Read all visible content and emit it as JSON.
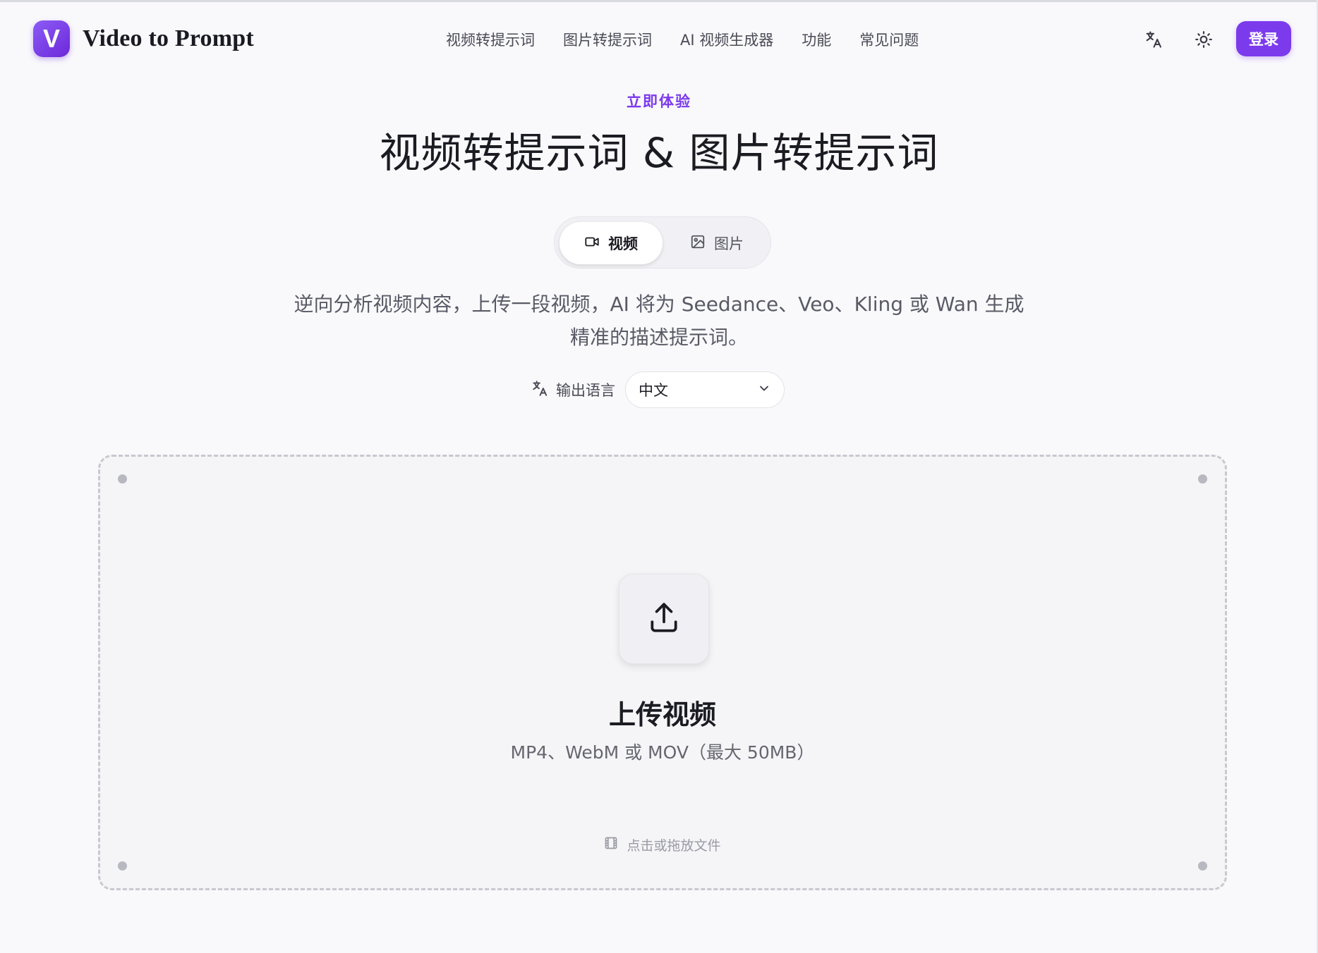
{
  "header": {
    "logo_letter": "V",
    "brand": "Video to Prompt",
    "nav": [
      {
        "label": "视频转提示词"
      },
      {
        "label": "图片转提示词"
      },
      {
        "label": "AI 视频生成器"
      },
      {
        "label": "功能"
      },
      {
        "label": "常见问题"
      }
    ],
    "icons": [
      "translate-icon",
      "sun-icon"
    ],
    "login_label": "登录"
  },
  "hero": {
    "eyebrow": "立即体验",
    "title": "视频转提示词 & 图片转提示词"
  },
  "mode_toggle": {
    "video_label": "视频",
    "image_label": "图片",
    "selected": "视频"
  },
  "description": {
    "line1": "逆向分析视频内容，上传一段视频，AI 将为 Seedance、Veo、Kling 或 Wan 生成",
    "line2": "精准的描述提示词。"
  },
  "output_language": {
    "label": "输出语言",
    "selected": "中文"
  },
  "upload": {
    "title": "上传视频",
    "formats": "MP4、WebM 或 MOV（最大 50MB）",
    "drop_note": "点击或拖放文件"
  },
  "colors": {
    "accent": "#7c3aed",
    "background": "#f9f9fc"
  }
}
